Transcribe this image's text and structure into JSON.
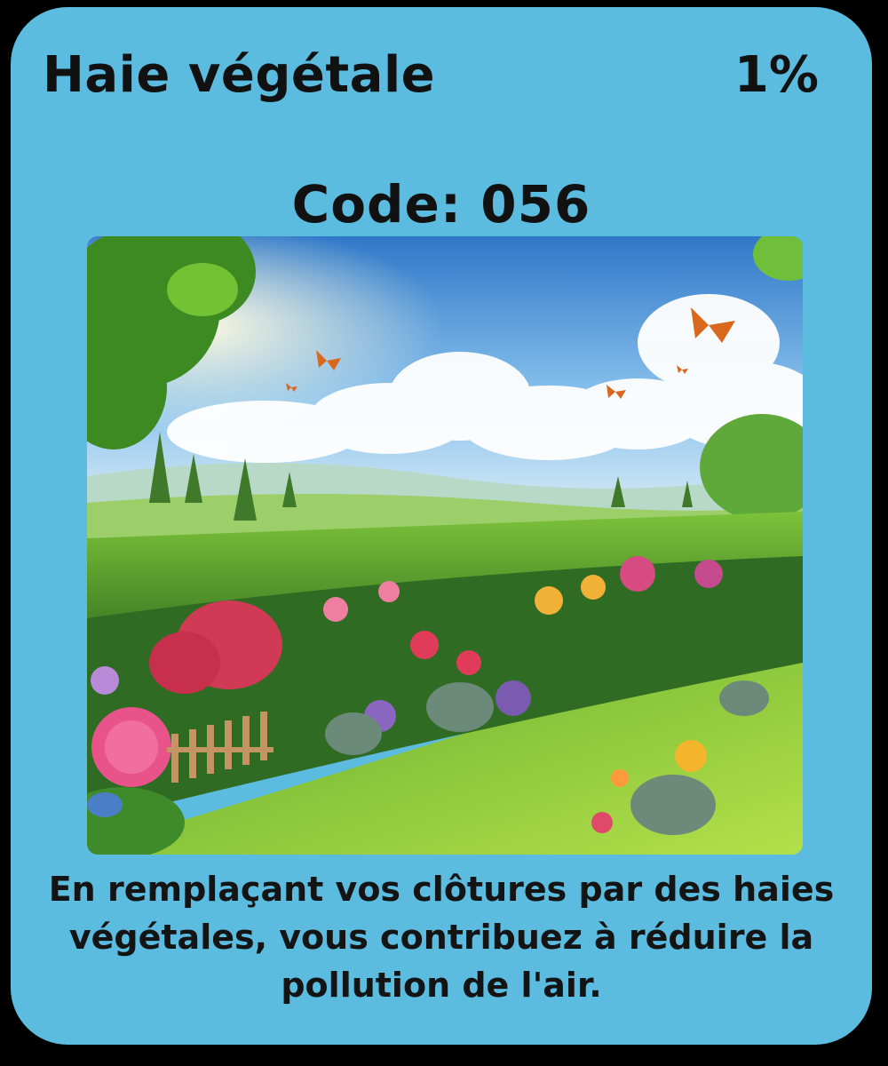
{
  "card": {
    "title": "Haie végétale",
    "percent": "1%",
    "code": "Code: 056",
    "description": "En remplaçant vos clôtures par des haies végétales, vous contribuez à réduire la pollution de l'air.",
    "illustration_icon": "garden-hedge-illustration"
  },
  "colors": {
    "card_background": "#5bbcdf",
    "page_background": "#000000",
    "text": "#111111",
    "sky_top": "#3f8fd6",
    "hedge": "#4f8f2a",
    "grass": "#8fcf3a"
  }
}
